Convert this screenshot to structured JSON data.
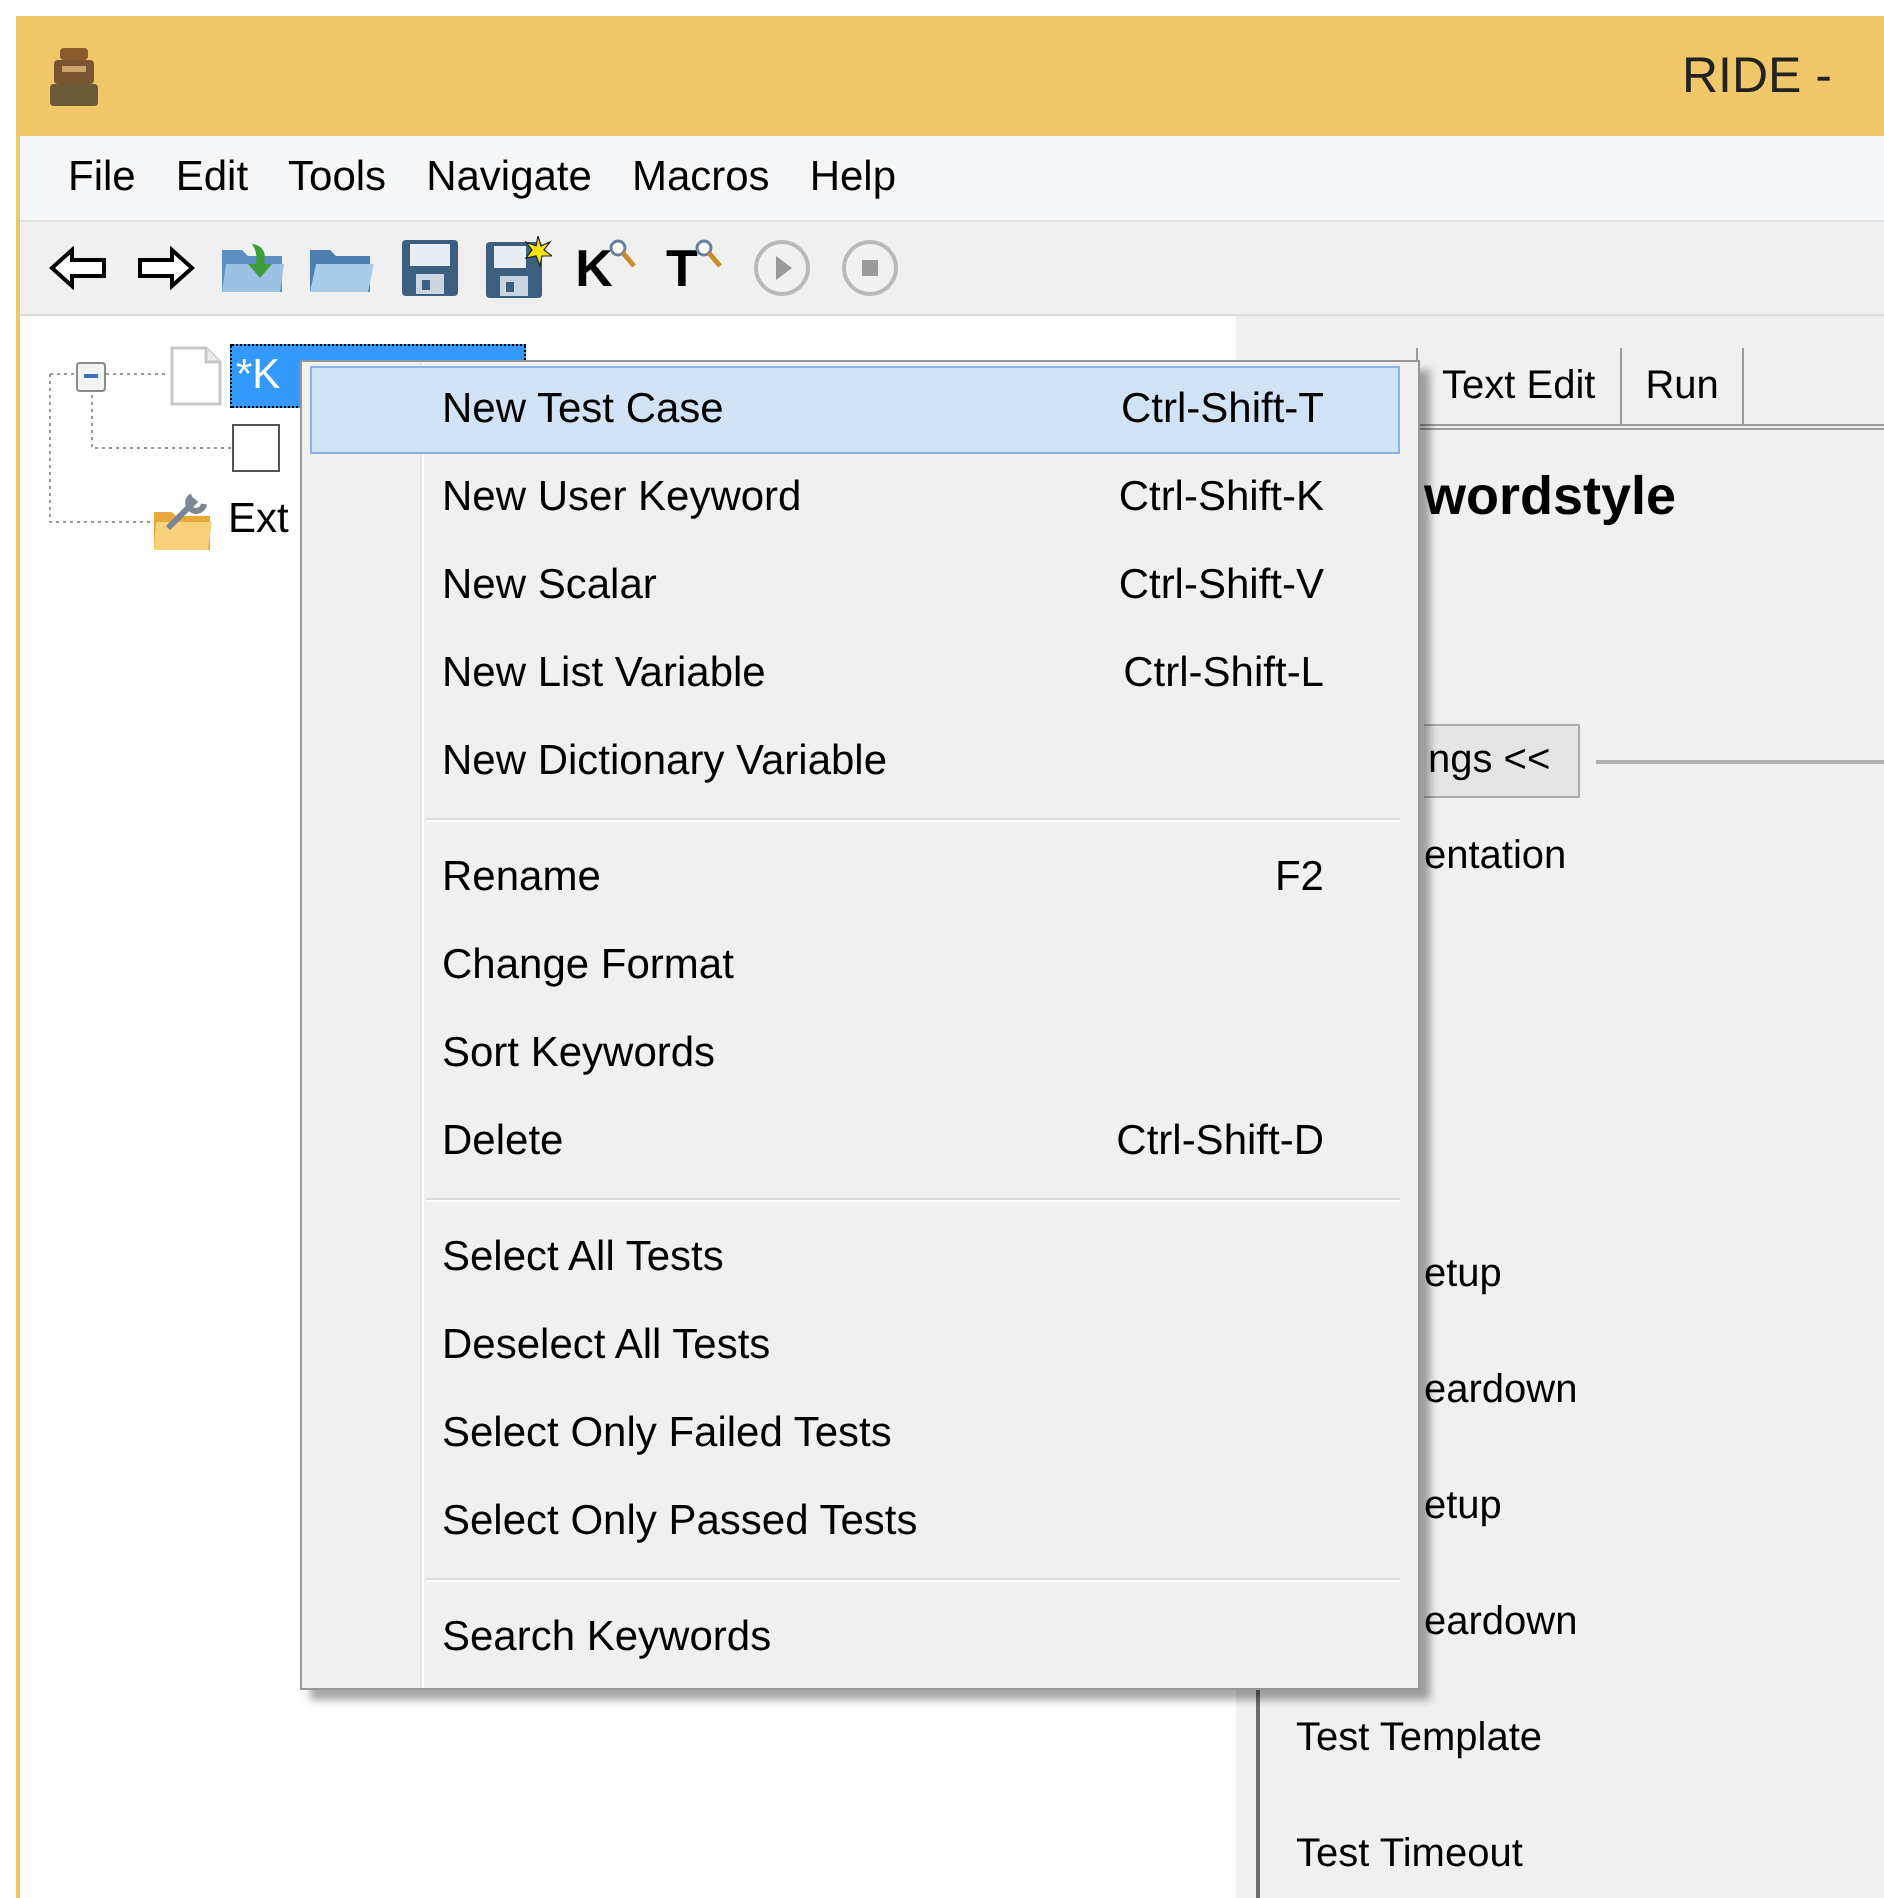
{
  "window": {
    "title": "RIDE -"
  },
  "menubar": [
    "File",
    "Edit",
    "Tools",
    "Navigate",
    "Macros",
    "Help"
  ],
  "toolbar": [
    {
      "kind": "back",
      "disabled": false
    },
    {
      "kind": "forward",
      "disabled": false
    },
    {
      "kind": "open-folder",
      "disabled": false
    },
    {
      "kind": "folder",
      "disabled": false
    },
    {
      "kind": "save",
      "disabled": false
    },
    {
      "kind": "save-all",
      "disabled": false
    },
    {
      "kind": "glyph-search",
      "glyph": "K",
      "disabled": false
    },
    {
      "kind": "glyph-search",
      "glyph": "T",
      "disabled": false
    },
    {
      "kind": "run",
      "disabled": true
    },
    {
      "kind": "stop",
      "disabled": true
    }
  ],
  "tree": [
    {
      "kind": "file",
      "label": "*K",
      "selected": true,
      "expanded": true,
      "children": [
        {
          "kind": "checkbox",
          "checked": false
        }
      ]
    },
    {
      "kind": "library",
      "label": "Ext",
      "selected": false
    }
  ],
  "editor": {
    "tabs": [
      {
        "label": "Text Edit",
        "selected": false
      },
      {
        "label": "Run",
        "selected": false
      }
    ],
    "heading": "wordstyle",
    "settings_button": "ngs <<",
    "settings": [
      "entation",
      "etup",
      "eardown",
      "etup",
      "eardown",
      "Test Template",
      "Test Timeout"
    ]
  },
  "context_menu": {
    "sections": [
      [
        {
          "label": "New Test Case",
          "shortcut": "Ctrl-Shift-T",
          "selected": true
        },
        {
          "label": "New User Keyword",
          "shortcut": "Ctrl-Shift-K",
          "selected": false
        },
        {
          "label": "New Scalar",
          "shortcut": "Ctrl-Shift-V",
          "selected": false
        },
        {
          "label": "New List Variable",
          "shortcut": "Ctrl-Shift-L",
          "selected": false
        },
        {
          "label": "New Dictionary Variable",
          "selected": false
        }
      ],
      [
        {
          "label": "Rename",
          "shortcut": "F2",
          "selected": false
        },
        {
          "label": "Change Format",
          "selected": false
        },
        {
          "label": "Sort Keywords",
          "selected": false
        },
        {
          "label": "Delete",
          "shortcut": "Ctrl-Shift-D",
          "selected": false
        }
      ],
      [
        {
          "label": "Select All Tests",
          "selected": false
        },
        {
          "label": "Deselect All Tests",
          "selected": false
        },
        {
          "label": "Select Only Failed Tests",
          "selected": false
        },
        {
          "label": "Select Only Passed Tests",
          "selected": false
        }
      ],
      [
        {
          "label": "Search Keywords",
          "selected": false
        }
      ]
    ]
  }
}
